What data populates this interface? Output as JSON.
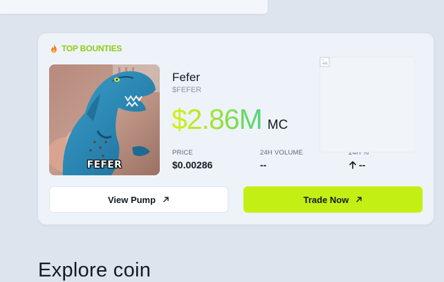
{
  "section": {
    "title": "TOP BOUNTIES",
    "accent": "#8fcc14",
    "icon": "flame-icon"
  },
  "token": {
    "name": "Fefer",
    "ticker": "$FEFER",
    "image_caption": "FEFER",
    "market_cap": "$2.86M",
    "market_cap_unit": "MC",
    "price_label": "PRICE",
    "price_value": "$0.00286",
    "volume_label": "24H VOLUME",
    "volume_value": "--",
    "change_label": "24H %",
    "change_value": "--",
    "change_icon": "arrow-up-icon"
  },
  "chart": {
    "state": "image not loaded",
    "icon": "broken-image-icon"
  },
  "actions": {
    "view_label": "View Pump",
    "trade_label": "Trade Now",
    "trade_color": "#c4ef14",
    "icon": "arrow-up-right-icon"
  },
  "below": {
    "heading_partial": "Explore coin"
  }
}
